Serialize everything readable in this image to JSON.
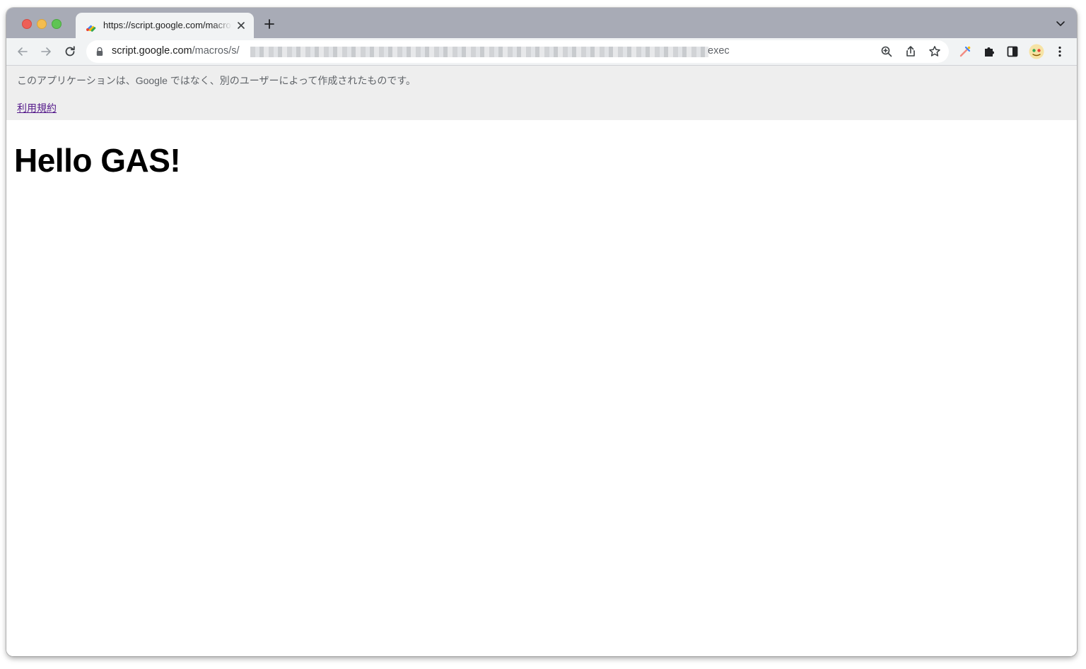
{
  "browser": {
    "tab": {
      "title": "https://script.google.com/macros/s/…/exec"
    },
    "address_bar": {
      "domain": "script.google.com",
      "path": "/macros/s/",
      "tail": "exec"
    }
  },
  "banner": {
    "notice": "このアプリケーションは、Google ではなく、別のユーザーによって作成されたものです。",
    "terms_link": "利用規約"
  },
  "page": {
    "heading": "Hello GAS!"
  },
  "colors": {
    "tabstrip": "#a8abb6",
    "toolbar": "#f1f3f4",
    "banner": "#eeeeee",
    "visited_link": "#551a8b"
  }
}
